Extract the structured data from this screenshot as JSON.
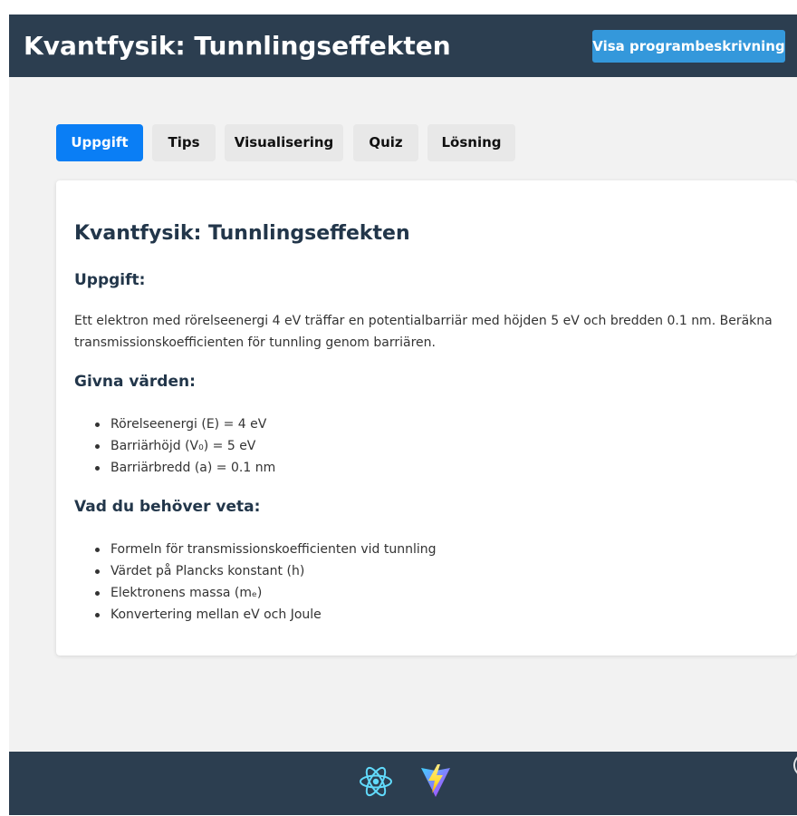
{
  "header": {
    "title": "Kvantfysik: Tunnlingseffekten",
    "description_button": "Visa programbeskrivning"
  },
  "tabs": [
    {
      "label": "Uppgift",
      "active": true
    },
    {
      "label": "Tips",
      "active": false
    },
    {
      "label": "Visualisering",
      "active": false
    },
    {
      "label": "Quiz",
      "active": false
    },
    {
      "label": "Lösning",
      "active": false
    }
  ],
  "content": {
    "title": "Kvantfysik: Tunnlingseffekten",
    "task_heading": "Uppgift:",
    "task_text": "Ett elektron med rörelseenergi 4 eV träffar en potentialbarriär med höjden 5 eV och bredden 0.1 nm. Beräkna transmissionskoefficienten för tunnling genom barriären.",
    "given_heading": "Givna värden:",
    "given_values": [
      "Rörelseenergi (E) = 4 eV",
      "Barriärhöjd (V₀) = 5 eV",
      "Barriärbredd (a) = 0.1 nm"
    ],
    "need_heading": "Vad du behöver veta:",
    "need_items": [
      "Formeln för transmissionskoefficienten vid tunnling",
      "Värdet på Plancks konstant (h)",
      "Elektronens massa (mₑ)",
      "Konvertering mellan eV och Joule"
    ]
  },
  "footer": {
    "icons": [
      "react-icon",
      "vite-icon"
    ]
  },
  "colors": {
    "header_bg": "#2c3e50",
    "accent_button": "#3498db",
    "active_tab": "#0a7ef5",
    "page_bg": "#f2f2f2",
    "heading_text": "#22364a"
  }
}
